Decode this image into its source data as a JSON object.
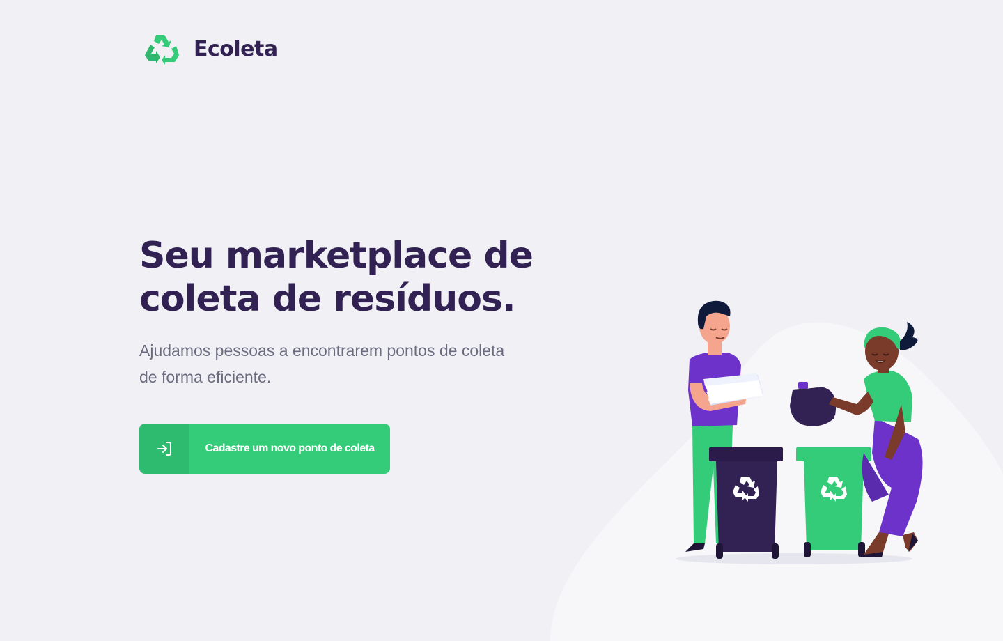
{
  "app": {
    "name": "Ecoleta",
    "logo_icon": "recycle-icon"
  },
  "hero": {
    "title_line1": "Seu marketplace de",
    "title_line2": "coleta de resíduos.",
    "subtitle_line1": "Ajudamos pessoas a encontrarem pontos de coleta",
    "subtitle_line2": "de forma eficiente."
  },
  "cta": {
    "label": "Cadastre um novo ponto de coleta",
    "icon": "log-in-icon"
  },
  "illustration": {
    "name": "people-recycling-illustration"
  },
  "colors": {
    "background": "#F0F0F5",
    "title": "#322153",
    "text": "#6C6C80",
    "primary": "#34CB79",
    "purple": "#6C32C9",
    "dark_purple": "#322153"
  }
}
